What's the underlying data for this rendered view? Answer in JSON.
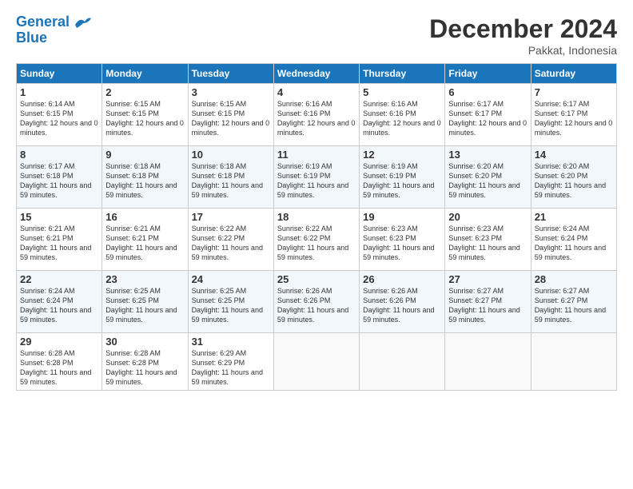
{
  "header": {
    "logo_line1": "General",
    "logo_line2": "Blue",
    "month_title": "December 2024",
    "location": "Pakkat, Indonesia"
  },
  "weekdays": [
    "Sunday",
    "Monday",
    "Tuesday",
    "Wednesday",
    "Thursday",
    "Friday",
    "Saturday"
  ],
  "weeks": [
    [
      {
        "day": 1,
        "sunrise": "6:14 AM",
        "sunset": "6:15 PM",
        "daylight": "12 hours and 0 minutes."
      },
      {
        "day": 2,
        "sunrise": "6:15 AM",
        "sunset": "6:15 PM",
        "daylight": "12 hours and 0 minutes."
      },
      {
        "day": 3,
        "sunrise": "6:15 AM",
        "sunset": "6:15 PM",
        "daylight": "12 hours and 0 minutes."
      },
      {
        "day": 4,
        "sunrise": "6:16 AM",
        "sunset": "6:16 PM",
        "daylight": "12 hours and 0 minutes."
      },
      {
        "day": 5,
        "sunrise": "6:16 AM",
        "sunset": "6:16 PM",
        "daylight": "12 hours and 0 minutes."
      },
      {
        "day": 6,
        "sunrise": "6:17 AM",
        "sunset": "6:17 PM",
        "daylight": "12 hours and 0 minutes."
      },
      {
        "day": 7,
        "sunrise": "6:17 AM",
        "sunset": "6:17 PM",
        "daylight": "12 hours and 0 minutes."
      }
    ],
    [
      {
        "day": 8,
        "sunrise": "6:17 AM",
        "sunset": "6:18 PM",
        "daylight": "11 hours and 59 minutes."
      },
      {
        "day": 9,
        "sunrise": "6:18 AM",
        "sunset": "6:18 PM",
        "daylight": "11 hours and 59 minutes."
      },
      {
        "day": 10,
        "sunrise": "6:18 AM",
        "sunset": "6:18 PM",
        "daylight": "11 hours and 59 minutes."
      },
      {
        "day": 11,
        "sunrise": "6:19 AM",
        "sunset": "6:19 PM",
        "daylight": "11 hours and 59 minutes."
      },
      {
        "day": 12,
        "sunrise": "6:19 AM",
        "sunset": "6:19 PM",
        "daylight": "11 hours and 59 minutes."
      },
      {
        "day": 13,
        "sunrise": "6:20 AM",
        "sunset": "6:20 PM",
        "daylight": "11 hours and 59 minutes."
      },
      {
        "day": 14,
        "sunrise": "6:20 AM",
        "sunset": "6:20 PM",
        "daylight": "11 hours and 59 minutes."
      }
    ],
    [
      {
        "day": 15,
        "sunrise": "6:21 AM",
        "sunset": "6:21 PM",
        "daylight": "11 hours and 59 minutes."
      },
      {
        "day": 16,
        "sunrise": "6:21 AM",
        "sunset": "6:21 PM",
        "daylight": "11 hours and 59 minutes."
      },
      {
        "day": 17,
        "sunrise": "6:22 AM",
        "sunset": "6:22 PM",
        "daylight": "11 hours and 59 minutes."
      },
      {
        "day": 18,
        "sunrise": "6:22 AM",
        "sunset": "6:22 PM",
        "daylight": "11 hours and 59 minutes."
      },
      {
        "day": 19,
        "sunrise": "6:23 AM",
        "sunset": "6:23 PM",
        "daylight": "11 hours and 59 minutes."
      },
      {
        "day": 20,
        "sunrise": "6:23 AM",
        "sunset": "6:23 PM",
        "daylight": "11 hours and 59 minutes."
      },
      {
        "day": 21,
        "sunrise": "6:24 AM",
        "sunset": "6:24 PM",
        "daylight": "11 hours and 59 minutes."
      }
    ],
    [
      {
        "day": 22,
        "sunrise": "6:24 AM",
        "sunset": "6:24 PM",
        "daylight": "11 hours and 59 minutes."
      },
      {
        "day": 23,
        "sunrise": "6:25 AM",
        "sunset": "6:25 PM",
        "daylight": "11 hours and 59 minutes."
      },
      {
        "day": 24,
        "sunrise": "6:25 AM",
        "sunset": "6:25 PM",
        "daylight": "11 hours and 59 minutes."
      },
      {
        "day": 25,
        "sunrise": "6:26 AM",
        "sunset": "6:26 PM",
        "daylight": "11 hours and 59 minutes."
      },
      {
        "day": 26,
        "sunrise": "6:26 AM",
        "sunset": "6:26 PM",
        "daylight": "11 hours and 59 minutes."
      },
      {
        "day": 27,
        "sunrise": "6:27 AM",
        "sunset": "6:27 PM",
        "daylight": "11 hours and 59 minutes."
      },
      {
        "day": 28,
        "sunrise": "6:27 AM",
        "sunset": "6:27 PM",
        "daylight": "11 hours and 59 minutes."
      }
    ],
    [
      {
        "day": 29,
        "sunrise": "6:28 AM",
        "sunset": "6:28 PM",
        "daylight": "11 hours and 59 minutes."
      },
      {
        "day": 30,
        "sunrise": "6:28 AM",
        "sunset": "6:28 PM",
        "daylight": "11 hours and 59 minutes."
      },
      {
        "day": 31,
        "sunrise": "6:29 AM",
        "sunset": "6:29 PM",
        "daylight": "11 hours and 59 minutes."
      },
      null,
      null,
      null,
      null
    ]
  ]
}
